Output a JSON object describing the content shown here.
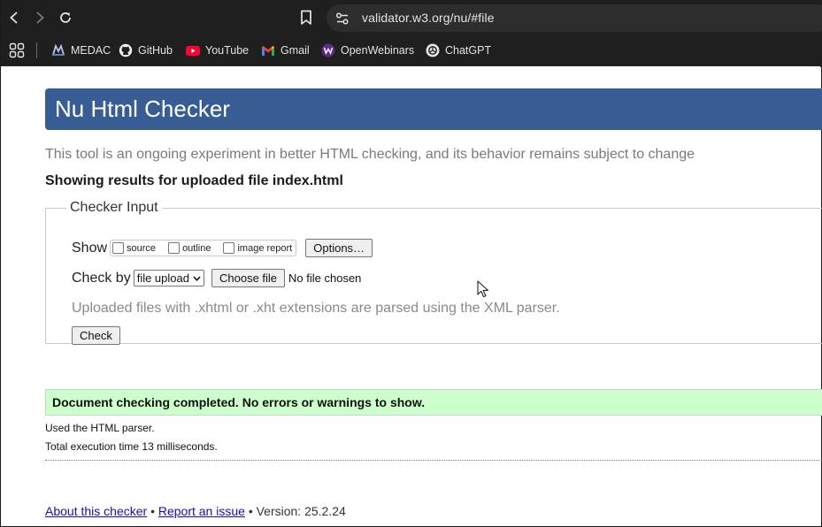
{
  "browser": {
    "url": "validator.w3.org/nu/#file",
    "bookmarks": [
      {
        "label": "MEDAC",
        "icon": "medac-icon"
      },
      {
        "label": "GitHub",
        "icon": "github-icon"
      },
      {
        "label": "YouTube",
        "icon": "youtube-icon"
      },
      {
        "label": "Gmail",
        "icon": "gmail-icon"
      },
      {
        "label": "OpenWebinars",
        "icon": "openwebinars-icon"
      },
      {
        "label": "ChatGPT",
        "icon": "chatgpt-icon"
      }
    ]
  },
  "page": {
    "title": "Nu Html Checker",
    "intro": "This tool is an ongoing experiment in better HTML checking, and its behavior remains subject to change",
    "results_heading": "Showing results for uploaded file index.html",
    "checker": {
      "legend": "Checker Input",
      "show_label": "Show",
      "show_options": [
        "source",
        "outline",
        "image report"
      ],
      "options_button": "Options…",
      "check_by_label": "Check by",
      "check_by_value": "file upload",
      "choose_file_button": "Choose file",
      "no_file_text": "No file chosen",
      "hint": "Uploaded files with .xhtml or .xht extensions are parsed using the XML parser.",
      "check_button": "Check"
    },
    "success_message": "Document checking completed. No errors or warnings to show.",
    "parser_info": "Used the HTML parser.",
    "execution_time": "Total execution time 13 milliseconds.",
    "footer": {
      "about_link": "About this checker",
      "sep1": "•",
      "report_link": "Report an issue",
      "version_text": "• Version: 25.2.24"
    }
  },
  "colors": {
    "title_bar": "#375d94",
    "success_bg": "#ccffcc",
    "chrome_bg": "#1f1f1f"
  }
}
